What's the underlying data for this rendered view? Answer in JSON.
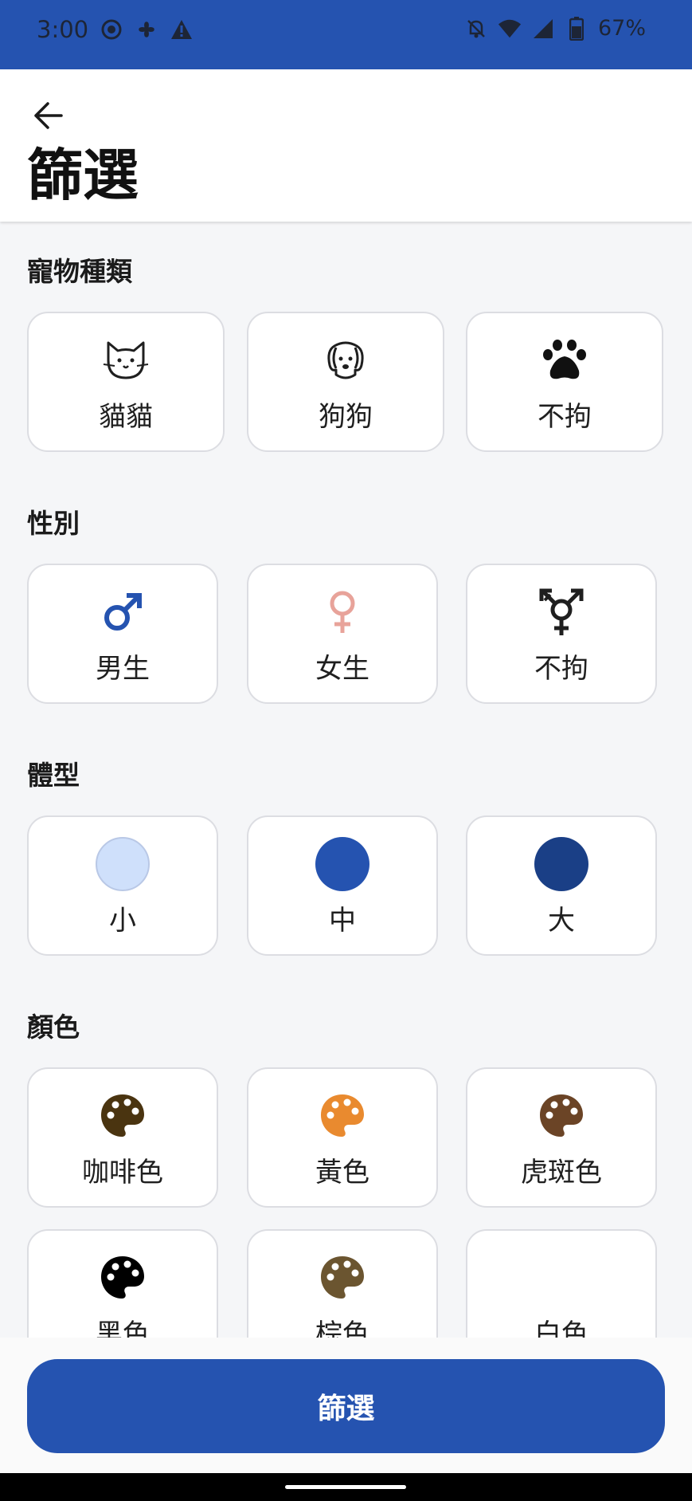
{
  "status_bar": {
    "time": "3:00",
    "battery": "67%",
    "icons_left": [
      "screen-record-icon",
      "fan-icon",
      "warning-icon"
    ],
    "icons_right": [
      "notifications-off-icon",
      "wifi-icon",
      "signal-icon",
      "battery-icon"
    ]
  },
  "header": {
    "back_icon": "arrow-left-icon",
    "title": "篩選"
  },
  "sections": {
    "pet_type": {
      "title": "寵物種類",
      "options": [
        {
          "label": "貓貓",
          "icon": "cat-icon"
        },
        {
          "label": "狗狗",
          "icon": "dog-icon"
        },
        {
          "label": "不拘",
          "icon": "paw-icon"
        }
      ]
    },
    "gender": {
      "title": "性別",
      "options": [
        {
          "label": "男生",
          "icon": "male-icon",
          "color": "#2553b0"
        },
        {
          "label": "女生",
          "icon": "female-icon",
          "color": "#e8a39a"
        },
        {
          "label": "不拘",
          "icon": "transgender-icon",
          "color": "#1f1f1f"
        }
      ]
    },
    "size": {
      "title": "體型",
      "options": [
        {
          "label": "小",
          "color": "#cfe0fb"
        },
        {
          "label": "中",
          "color": "#2553b0"
        },
        {
          "label": "大",
          "color": "#1a3f86"
        }
      ]
    },
    "color": {
      "title": "顏色",
      "options": [
        {
          "label": "咖啡色",
          "icon": "palette-icon",
          "color": "#4a3410"
        },
        {
          "label": "黃色",
          "icon": "palette-icon",
          "color": "#e98a2f"
        },
        {
          "label": "虎斑色",
          "icon": "palette-icon",
          "color": "#6b4426"
        },
        {
          "label": "黑色",
          "icon": "palette-icon",
          "color": "#000000"
        },
        {
          "label": "棕色",
          "icon": "palette-icon",
          "color": "#6b5530"
        },
        {
          "label": "白色",
          "icon": "palette-icon",
          "color": "#ffffff"
        }
      ]
    }
  },
  "footer": {
    "filter_button": "篩選"
  },
  "colors": {
    "primary": "#2553b0"
  }
}
